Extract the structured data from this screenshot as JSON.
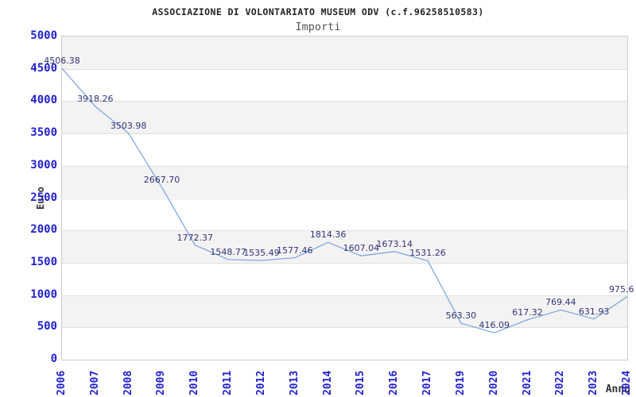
{
  "chart_data": {
    "type": "line",
    "title": "ASSOCIAZIONE DI VOLONTARIATO MUSEUM ODV (c.f.96258510583)",
    "subtitle": "Importi",
    "xlabel": "Anno",
    "ylabel": "Euro",
    "categories": [
      "2006",
      "2007",
      "2008",
      "2009",
      "2010",
      "2011",
      "2012",
      "2013",
      "2014",
      "2015",
      "2016",
      "2017",
      "2019",
      "2020",
      "2021",
      "2022",
      "2023",
      "2024"
    ],
    "values": [
      4506.38,
      3918.26,
      3503.98,
      2667.7,
      1772.37,
      1548.77,
      1535.49,
      1577.46,
      1814.36,
      1607.04,
      1673.14,
      1531.26,
      563.3,
      416.09,
      617.32,
      769.44,
      631.93,
      975.6
    ],
    "point_labels": [
      "4506.38",
      "3918.26",
      "3503.98",
      "2667.70",
      "1772.37",
      "1548.77",
      "1535.49",
      "1577.46",
      "1814.36",
      "1607.04",
      "1673.14",
      "1531.26",
      "563.30",
      "416.09",
      "617.32",
      "769.44",
      "631.93",
      "975.6"
    ],
    "ylim": [
      0,
      5000
    ],
    "ytick_step": 500,
    "grid": "alternating horizontal bands, no vertical gridlines",
    "legend_position": "none",
    "colors": {
      "line": "#7fa9dc",
      "tick_label": "#2222cc",
      "point_label": "#333377",
      "band": "#f3f3f3",
      "gridline": "#e0e0e0",
      "plot_border": "#cccccc",
      "title": "#222222",
      "subtitle": "#555555",
      "axis_title": "#333333",
      "background": "#ffffff"
    }
  }
}
